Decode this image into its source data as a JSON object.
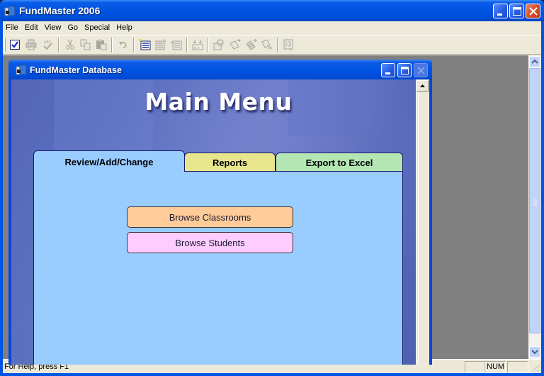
{
  "app": {
    "title": "FundMaster 2006",
    "caption_buttons": [
      "minimize",
      "maximize",
      "close"
    ]
  },
  "menu": {
    "items": [
      "File",
      "Edit",
      "View",
      "Go",
      "Special",
      "Help"
    ]
  },
  "toolbar": {
    "buttons": [
      {
        "icon": "checkbox-icon",
        "enabled": true
      },
      {
        "icon": "print-icon",
        "enabled": false
      },
      {
        "icon": "spellcheck-icon",
        "enabled": false
      },
      {
        "icon": "cut-icon",
        "enabled": false
      },
      {
        "icon": "copy-icon",
        "enabled": false
      },
      {
        "icon": "paste-icon",
        "enabled": false
      },
      {
        "icon": "undo-icon",
        "enabled": false
      },
      {
        "icon": "new-record-icon",
        "enabled": true
      },
      {
        "icon": "record-settings-icon",
        "enabled": false
      },
      {
        "icon": "delete-record-icon",
        "enabled": false
      },
      {
        "icon": "sort-az-icon",
        "enabled": false
      },
      {
        "icon": "filter-icon",
        "enabled": false
      },
      {
        "icon": "apply-filter-icon",
        "enabled": false
      },
      {
        "icon": "remove-filter-icon",
        "enabled": false
      },
      {
        "icon": "clear-filter-icon",
        "enabled": false
      },
      {
        "icon": "report-icon",
        "enabled": false
      }
    ]
  },
  "child_window": {
    "title": "FundMaster Database",
    "form": {
      "heading": "Main Menu",
      "tabs": [
        {
          "label": "Review/Add/Change",
          "active": true,
          "color": "#99ccff"
        },
        {
          "label": "Reports",
          "active": false,
          "color": "#e8e68c"
        },
        {
          "label": "Export to Excel",
          "active": false,
          "color": "#b4e6b4"
        }
      ],
      "buttons": [
        {
          "label": "Browse Classrooms",
          "color": "#ffcc99"
        },
        {
          "label": "Browse Students",
          "color": "#ffccff"
        }
      ]
    }
  },
  "statusbar": {
    "message": "For Help, press F1",
    "panes": [
      "",
      "NUM",
      ""
    ]
  }
}
